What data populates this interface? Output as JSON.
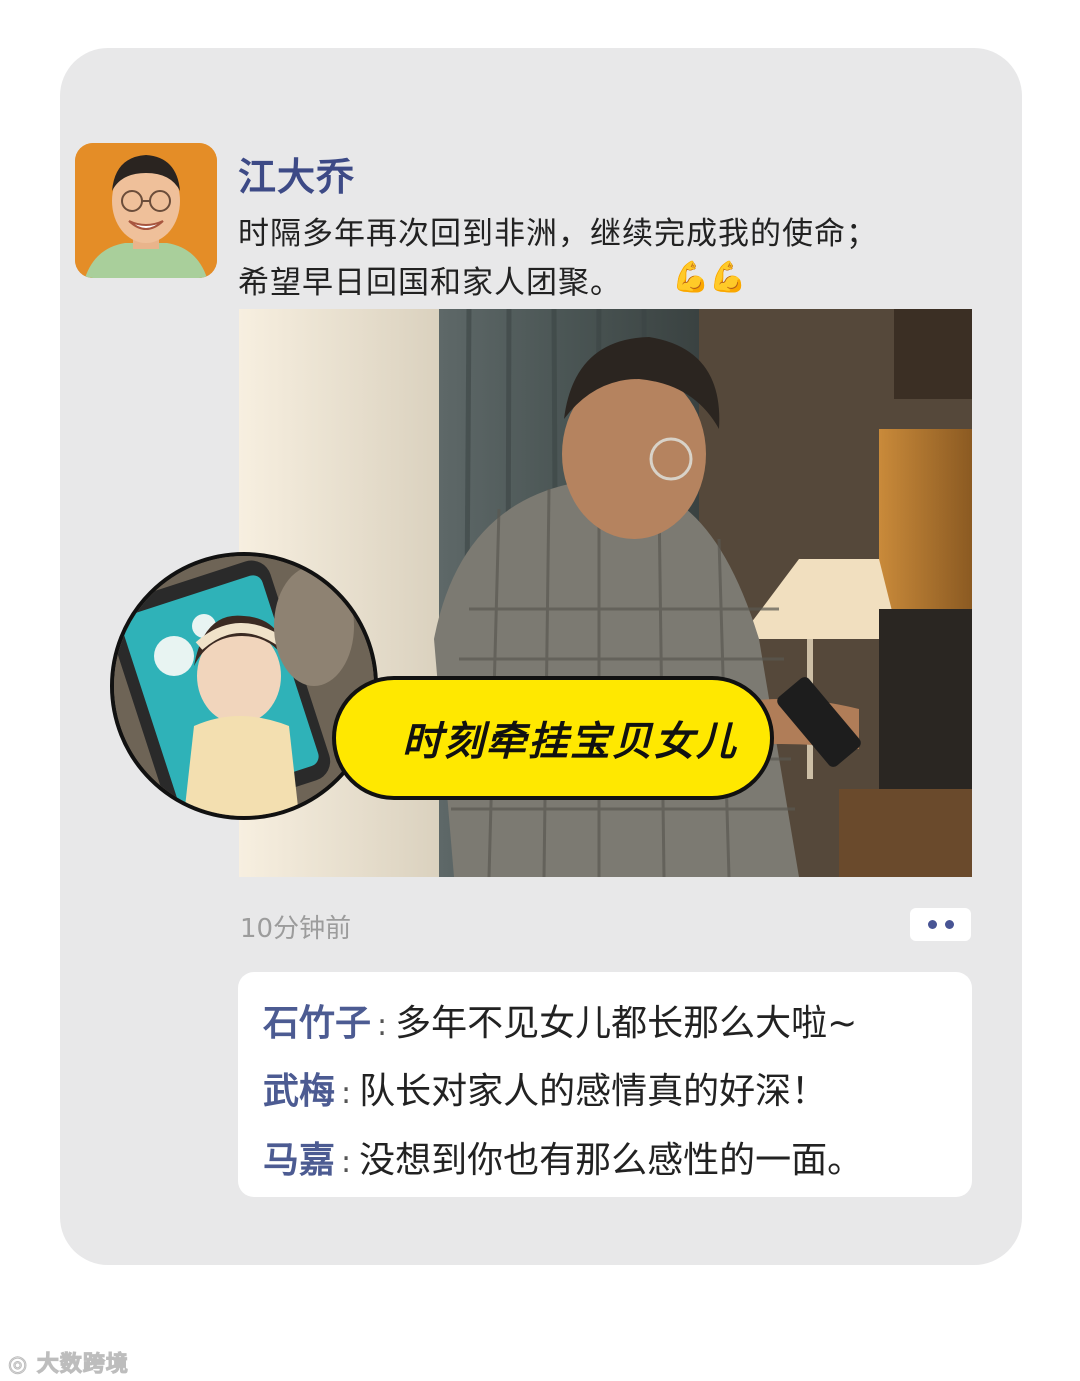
{
  "post": {
    "author": "江大乔",
    "text_line1": "时隔多年再次回到非洲，继续完成我的使命；",
    "text_line2": "希望早日回国和家人团聚。",
    "emoji": "💪💪",
    "image_caption": "时刻牵挂宝贝女儿",
    "timestamp": "10分钟前"
  },
  "comments": [
    {
      "name": "石竹子",
      "text": "多年不见女儿都长那么大啦~"
    },
    {
      "name": "武梅",
      "text": "队长对家人的感情真的好深！"
    },
    {
      "name": "马嘉",
      "text": "没想到你也有那么感性的一面。"
    }
  ],
  "watermark": "大数跨境",
  "colors": {
    "card_bg": "#e8e8e9",
    "name_blue": "#3d4a86",
    "caption_yellow": "#ffe800"
  }
}
